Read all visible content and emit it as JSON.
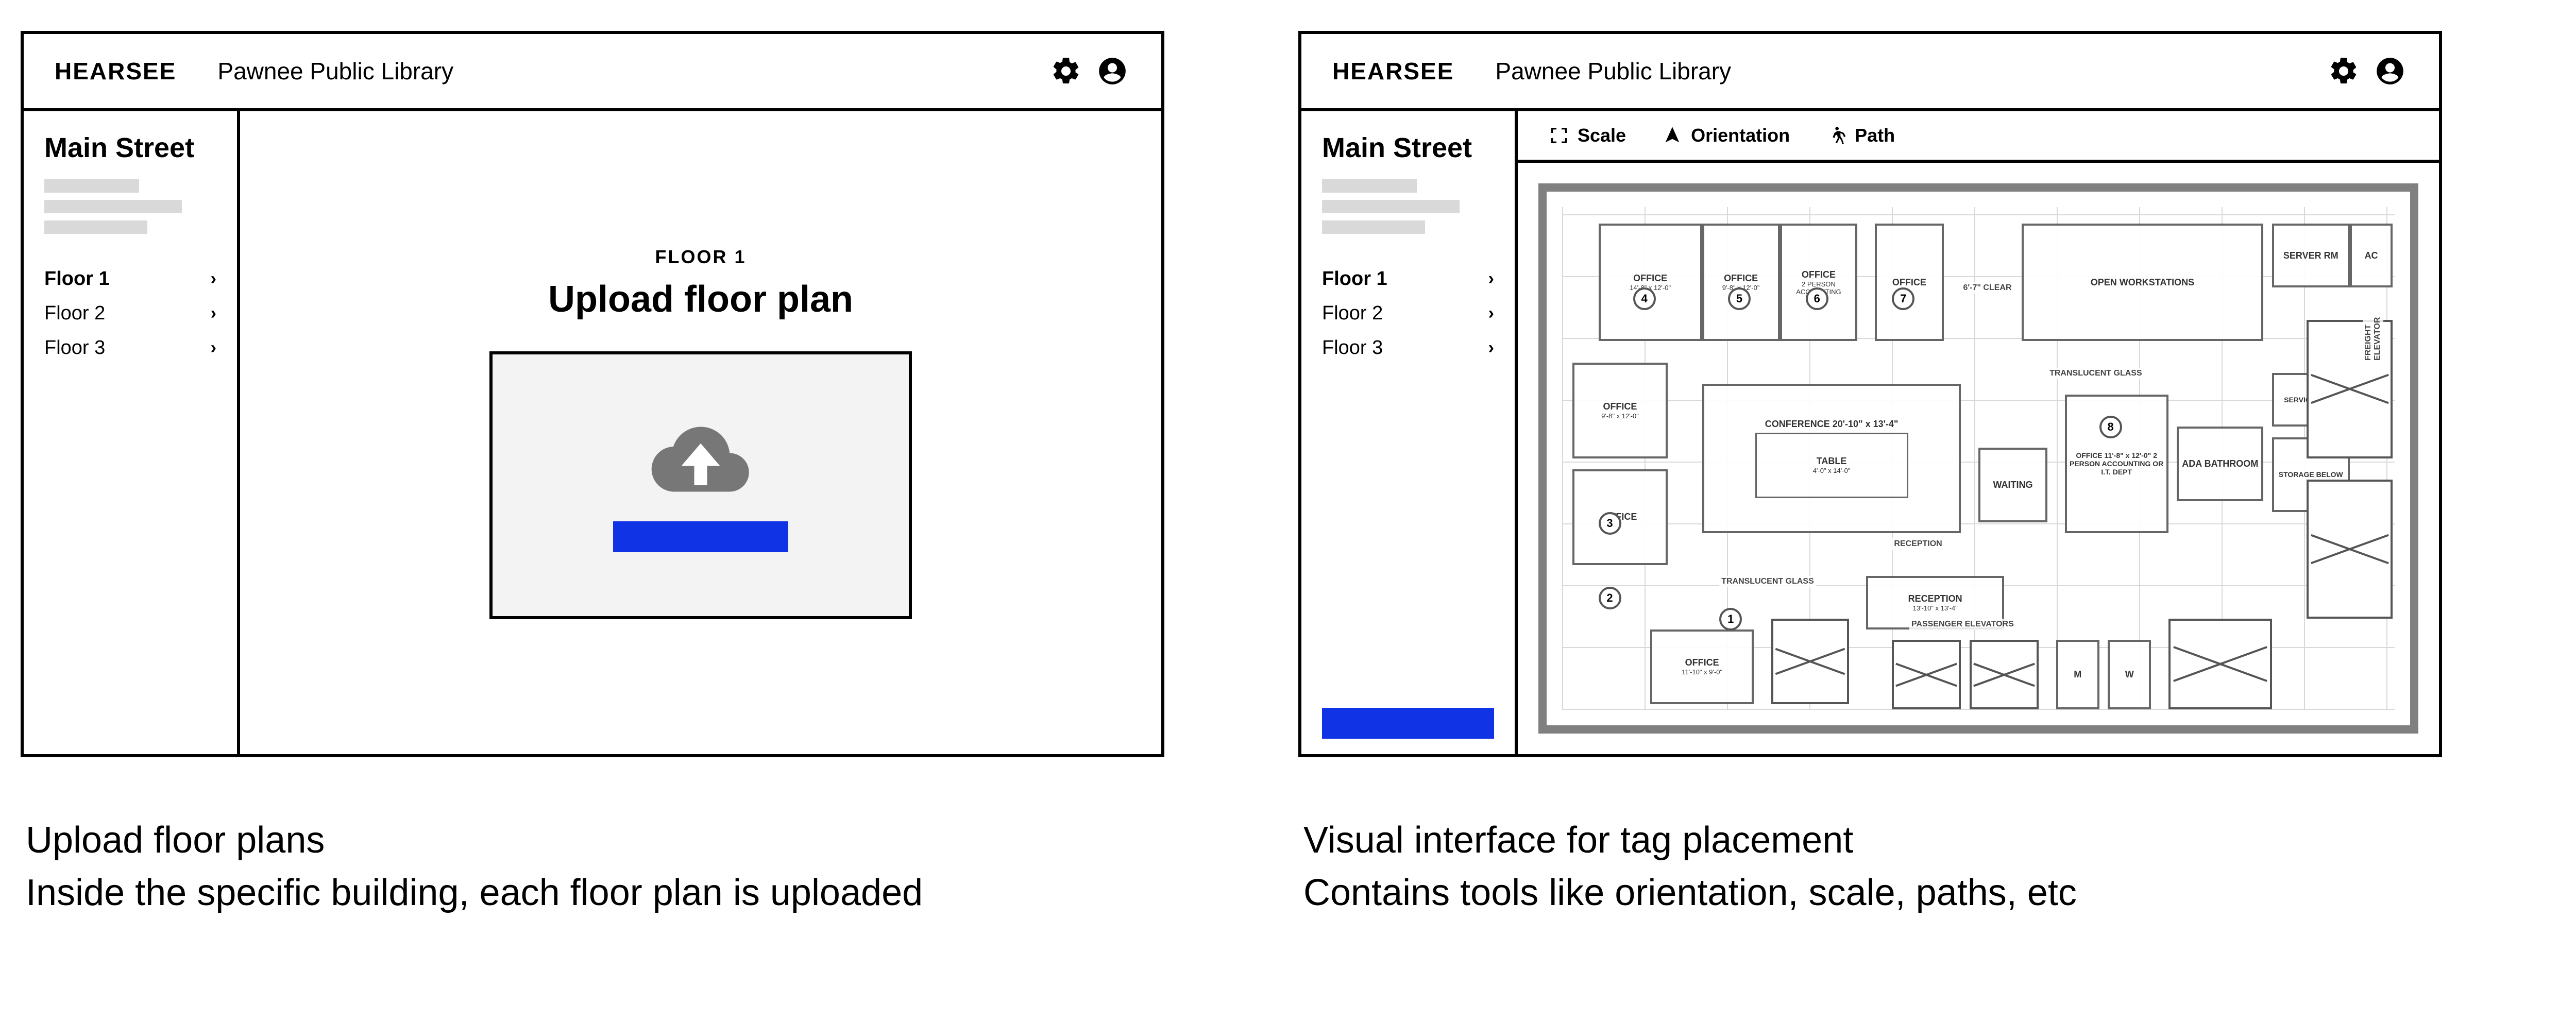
{
  "brand": "HEARSEE",
  "location": "Pawnee Public Library",
  "sidebar": {
    "heading": "Main Street",
    "floors": [
      {
        "label": "Floor 1",
        "active": true
      },
      {
        "label": "Floor 2",
        "active": false
      },
      {
        "label": "Floor 3",
        "active": false
      }
    ]
  },
  "upload": {
    "floor_label": "FLOOR 1",
    "title": "Upload floor plan"
  },
  "toolbar": {
    "scale": "Scale",
    "orientation": "Orientation",
    "path": "Path"
  },
  "floorplan": {
    "rooms": {
      "office1": "OFFICE",
      "office1_dim": "14'-8\" x 12'-0\"",
      "office2": "OFFICE",
      "office2_dim": "9'-8\" x 12'-0\"",
      "office3": "OFFICE",
      "office3_dim": "9'-8\" x 12'-0\"",
      "accounting": "2 PERSON ACCOUNTING",
      "open_ws": "OPEN WORKSTATIONS",
      "server": "SERVER RM",
      "ac": "AC",
      "office_side1": "OFFICE",
      "office_side1_dim": "9'-8\" x 12'-0\"",
      "office_side2": "OFFICE",
      "office_side3": "OFFICE",
      "office_side3_dim": "11'-10\" x 9'-0\"",
      "conference": "CONFERENCE  20'-10\" x 13'-4\"",
      "table": "TABLE",
      "table_dim": "4'-0\" x 14'-0\"",
      "reception": "RECEPTION",
      "waiting": "WAITING",
      "accounting_office": "OFFICE 11'-8\" x 12'-0\" 2 PERSON ACCOUNTING OR I.T. DEPT",
      "ada_bath": "ADA BATHROOM",
      "storage": "STORAGE BELOW",
      "service": "SERVICE AREA",
      "reception_lobby": "RECEPTION",
      "reception_lobby_dim": "13'-10\" x 13'-4\"",
      "elevators": "PASSENGER ELEVATORS",
      "office_bottom": "OFFICE",
      "office_bottom_dim": "11'-10\" x 9'-0\"",
      "translucent": "TRANSLUCENT GLASS",
      "clear": "6'-7\" CLEAR",
      "freight": "FREIGHT ELEVATOR",
      "mens": "M",
      "womens": "W"
    }
  },
  "captions": {
    "left_title": "Upload floor plans",
    "left_sub": "Inside the specific building, each floor plan is uploaded",
    "right_title": "Visual interface for tag placement",
    "right_sub": "Contains tools like orientation, scale, paths, etc"
  }
}
